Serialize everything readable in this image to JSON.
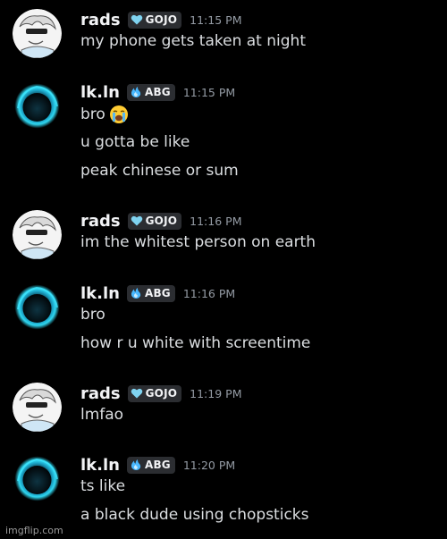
{
  "messages": [
    {
      "user": "rads",
      "tag": "GOJO",
      "tag_icon": "heart-icon",
      "time": "11:15 PM",
      "avatar": "anime-character-avatar",
      "lines": [
        "my phone gets taken at night"
      ]
    },
    {
      "user": "lk.ln",
      "tag": "ABG",
      "tag_icon": "flame-icon",
      "time": "11:15 PM",
      "avatar": "blue-orb-avatar",
      "lines": [
        "bro",
        "u gotta be like",
        "peak chinese or sum"
      ],
      "emoji": "loudly-crying-face-emoji"
    },
    {
      "user": "rads",
      "tag": "GOJO",
      "tag_icon": "heart-icon",
      "time": "11:16 PM",
      "avatar": "anime-character-avatar",
      "lines": [
        "im the whitest person on earth"
      ]
    },
    {
      "user": "lk.ln",
      "tag": "ABG",
      "tag_icon": "flame-icon",
      "time": "11:16 PM",
      "avatar": "blue-orb-avatar",
      "lines": [
        "bro",
        "how r u white with screentime"
      ]
    },
    {
      "user": "rads",
      "tag": "GOJO",
      "tag_icon": "heart-icon",
      "time": "11:19 PM",
      "avatar": "anime-character-avatar",
      "lines": [
        "lmfao"
      ]
    },
    {
      "user": "lk.ln",
      "tag": "ABG",
      "tag_icon": "flame-icon",
      "time": "11:20 PM",
      "avatar": "blue-orb-avatar",
      "lines": [
        "ts like",
        "a black dude using chopsticks"
      ]
    }
  ],
  "watermark": "imgflip.com",
  "colors": {
    "background": "#000000",
    "username": "#f2f3f5",
    "message_text": "#dbdee1",
    "timestamp": "#949ba4",
    "tag_bg": "#2b2d31",
    "heart": "#7fd3f0",
    "flame": "#49b8ff"
  }
}
